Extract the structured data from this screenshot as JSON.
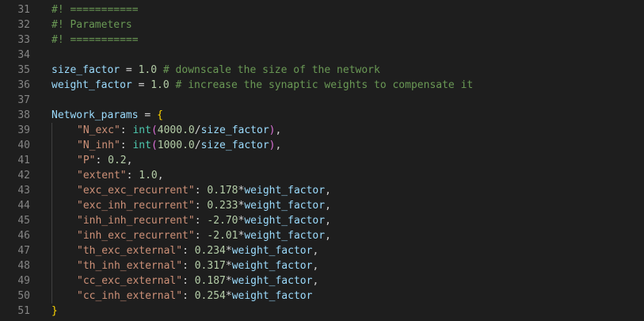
{
  "editor": {
    "lines": [
      {
        "num": "31",
        "segments": [
          {
            "t": "#! ===========",
            "c": "c"
          }
        ]
      },
      {
        "num": "32",
        "segments": [
          {
            "t": "#! Parameters",
            "c": "c"
          }
        ]
      },
      {
        "num": "33",
        "segments": [
          {
            "t": "#! ===========",
            "c": "c"
          }
        ]
      },
      {
        "num": "34",
        "segments": []
      },
      {
        "num": "35",
        "segments": [
          {
            "t": "size_factor",
            "c": "v"
          },
          {
            "t": " = ",
            "c": "o"
          },
          {
            "t": "1.0",
            "c": "n"
          },
          {
            "t": " # downscale the size of the network",
            "c": "c"
          }
        ]
      },
      {
        "num": "36",
        "segments": [
          {
            "t": "weight_factor",
            "c": "v"
          },
          {
            "t": " = ",
            "c": "o"
          },
          {
            "t": "1.0",
            "c": "n"
          },
          {
            "t": " # increase the synaptic weights to compensate it",
            "c": "c"
          }
        ]
      },
      {
        "num": "37",
        "segments": []
      },
      {
        "num": "38",
        "segments": [
          {
            "t": "Network_params",
            "c": "v"
          },
          {
            "t": " = ",
            "c": "o"
          },
          {
            "t": "{",
            "c": "b1"
          }
        ]
      },
      {
        "num": "39",
        "indent": 1,
        "segments": [
          {
            "t": "\"N_exc\"",
            "c": "s"
          },
          {
            "t": ": ",
            "c": "o"
          },
          {
            "t": "int",
            "c": "f"
          },
          {
            "t": "(",
            "c": "b2"
          },
          {
            "t": "4000.0",
            "c": "n"
          },
          {
            "t": "/",
            "c": "o"
          },
          {
            "t": "size_factor",
            "c": "v"
          },
          {
            "t": ")",
            "c": "b2"
          },
          {
            "t": ",",
            "c": "o"
          }
        ]
      },
      {
        "num": "40",
        "indent": 1,
        "segments": [
          {
            "t": "\"N_inh\"",
            "c": "s"
          },
          {
            "t": ": ",
            "c": "o"
          },
          {
            "t": "int",
            "c": "f"
          },
          {
            "t": "(",
            "c": "b2"
          },
          {
            "t": "1000.0",
            "c": "n"
          },
          {
            "t": "/",
            "c": "o"
          },
          {
            "t": "size_factor",
            "c": "v"
          },
          {
            "t": ")",
            "c": "b2"
          },
          {
            "t": ",",
            "c": "o"
          }
        ]
      },
      {
        "num": "41",
        "indent": 1,
        "segments": [
          {
            "t": "\"P\"",
            "c": "s"
          },
          {
            "t": ": ",
            "c": "o"
          },
          {
            "t": "0.2",
            "c": "n"
          },
          {
            "t": ",",
            "c": "o"
          }
        ]
      },
      {
        "num": "42",
        "indent": 1,
        "segments": [
          {
            "t": "\"extent\"",
            "c": "s"
          },
          {
            "t": ": ",
            "c": "o"
          },
          {
            "t": "1.0",
            "c": "n"
          },
          {
            "t": ",",
            "c": "o"
          }
        ]
      },
      {
        "num": "43",
        "indent": 1,
        "segments": [
          {
            "t": "\"exc_exc_recurrent\"",
            "c": "s"
          },
          {
            "t": ": ",
            "c": "o"
          },
          {
            "t": "0.178",
            "c": "n"
          },
          {
            "t": "*",
            "c": "o"
          },
          {
            "t": "weight_factor",
            "c": "v"
          },
          {
            "t": ",",
            "c": "o"
          }
        ]
      },
      {
        "num": "44",
        "indent": 1,
        "segments": [
          {
            "t": "\"exc_inh_recurrent\"",
            "c": "s"
          },
          {
            "t": ": ",
            "c": "o"
          },
          {
            "t": "0.233",
            "c": "n"
          },
          {
            "t": "*",
            "c": "o"
          },
          {
            "t": "weight_factor",
            "c": "v"
          },
          {
            "t": ",",
            "c": "o"
          }
        ]
      },
      {
        "num": "45",
        "indent": 1,
        "segments": [
          {
            "t": "\"inh_inh_recurrent\"",
            "c": "s"
          },
          {
            "t": ": ",
            "c": "o"
          },
          {
            "t": "-2.70",
            "c": "n"
          },
          {
            "t": "*",
            "c": "o"
          },
          {
            "t": "weight_factor",
            "c": "v"
          },
          {
            "t": ",",
            "c": "o"
          }
        ]
      },
      {
        "num": "46",
        "indent": 1,
        "segments": [
          {
            "t": "\"inh_exc_recurrent\"",
            "c": "s"
          },
          {
            "t": ": ",
            "c": "o"
          },
          {
            "t": "-2.01",
            "c": "n"
          },
          {
            "t": "*",
            "c": "o"
          },
          {
            "t": "weight_factor",
            "c": "v"
          },
          {
            "t": ",",
            "c": "o"
          }
        ]
      },
      {
        "num": "47",
        "indent": 1,
        "segments": [
          {
            "t": "\"th_exc_external\"",
            "c": "s"
          },
          {
            "t": ": ",
            "c": "o"
          },
          {
            "t": "0.234",
            "c": "n"
          },
          {
            "t": "*",
            "c": "o"
          },
          {
            "t": "weight_factor",
            "c": "v"
          },
          {
            "t": ",",
            "c": "o"
          }
        ]
      },
      {
        "num": "48",
        "indent": 1,
        "segments": [
          {
            "t": "\"th_inh_external\"",
            "c": "s"
          },
          {
            "t": ": ",
            "c": "o"
          },
          {
            "t": "0.317",
            "c": "n"
          },
          {
            "t": "*",
            "c": "o"
          },
          {
            "t": "weight_factor",
            "c": "v"
          },
          {
            "t": ",",
            "c": "o"
          }
        ]
      },
      {
        "num": "49",
        "indent": 1,
        "segments": [
          {
            "t": "\"cc_exc_external\"",
            "c": "s"
          },
          {
            "t": ": ",
            "c": "o"
          },
          {
            "t": "0.187",
            "c": "n"
          },
          {
            "t": "*",
            "c": "o"
          },
          {
            "t": "weight_factor",
            "c": "v"
          },
          {
            "t": ",",
            "c": "o"
          }
        ]
      },
      {
        "num": "50",
        "indent": 1,
        "segments": [
          {
            "t": "\"cc_inh_external\"",
            "c": "s"
          },
          {
            "t": ": ",
            "c": "o"
          },
          {
            "t": "0.254",
            "c": "n"
          },
          {
            "t": "*",
            "c": "o"
          },
          {
            "t": "weight_factor",
            "c": "v"
          }
        ]
      },
      {
        "num": "51",
        "segments": [
          {
            "t": "}",
            "c": "b1"
          }
        ]
      }
    ]
  },
  "colors": {
    "background": "#1e1e1e",
    "line_number": "#858585",
    "comment": "#6a9955",
    "variable": "#9cdcfe",
    "number": "#b5cea8",
    "string": "#ce9178",
    "builtin": "#4ec9b0",
    "bracket_outer": "#ffd700",
    "bracket_inner": "#da70d6"
  }
}
